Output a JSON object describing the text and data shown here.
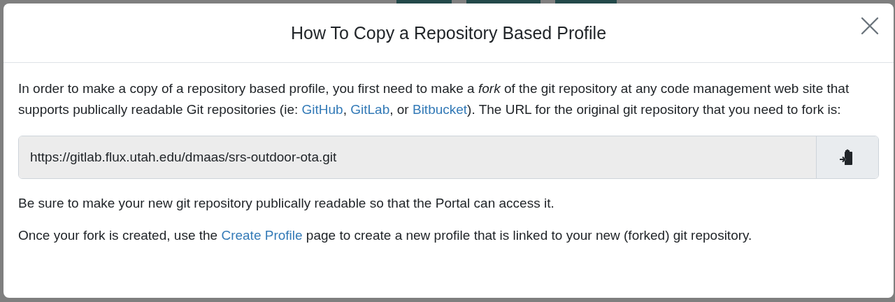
{
  "dialog": {
    "title": "How To Copy a Repository Based Profile",
    "paragraphs": [
      {
        "segments": [
          {
            "kind": "text",
            "text": "In order to make a copy of a repository based profile, you first need to make a "
          },
          {
            "kind": "italic",
            "text": "fork"
          },
          {
            "kind": "text",
            "text": " of the git repository at any code management web site that supports publically readable Git repositories (ie: "
          },
          {
            "kind": "link",
            "text": "GitHub"
          },
          {
            "kind": "text",
            "text": ", "
          },
          {
            "kind": "link",
            "text": "GitLab"
          },
          {
            "kind": "text",
            "text": ", or "
          },
          {
            "kind": "link",
            "text": "Bitbucket"
          },
          {
            "kind": "text",
            "text": "). The URL for the original git repository that you need to fork is:"
          }
        ]
      },
      {
        "kind": "url",
        "value": "https://gitlab.flux.utah.edu/dmaas/srs-outdoor-ota.git"
      },
      {
        "segments": [
          {
            "kind": "text",
            "text": "Be sure to make your new git repository publically readable so that the Portal can access it."
          }
        ]
      },
      {
        "segments": [
          {
            "kind": "text",
            "text": "Once your fork is created, use the "
          },
          {
            "kind": "link",
            "text": "Create Profile"
          },
          {
            "kind": "text",
            "text": " page to create a new profile that is linked to your new (forked) git repository."
          }
        ]
      }
    ]
  }
}
